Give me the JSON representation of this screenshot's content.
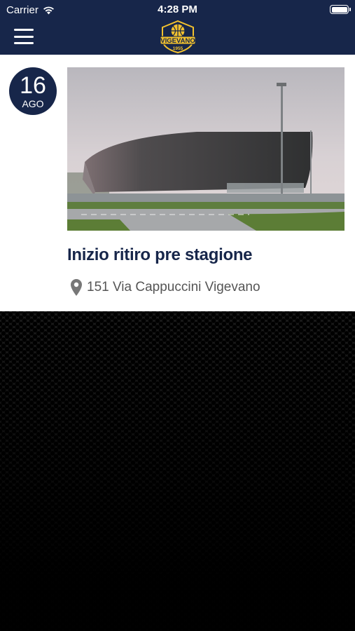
{
  "status_bar": {
    "carrier": "Carrier",
    "time": "4:28 PM"
  },
  "header": {
    "logo_text": "VIGEVANO",
    "logo_year": "1955",
    "brand_color": "#17264a",
    "accent_color": "#f2c12e"
  },
  "events": [
    {
      "day": "16",
      "month": "AGO",
      "title": "Inizio ritiro pre stagione",
      "location": "151 Via Cappuccini Vigevano"
    }
  ]
}
